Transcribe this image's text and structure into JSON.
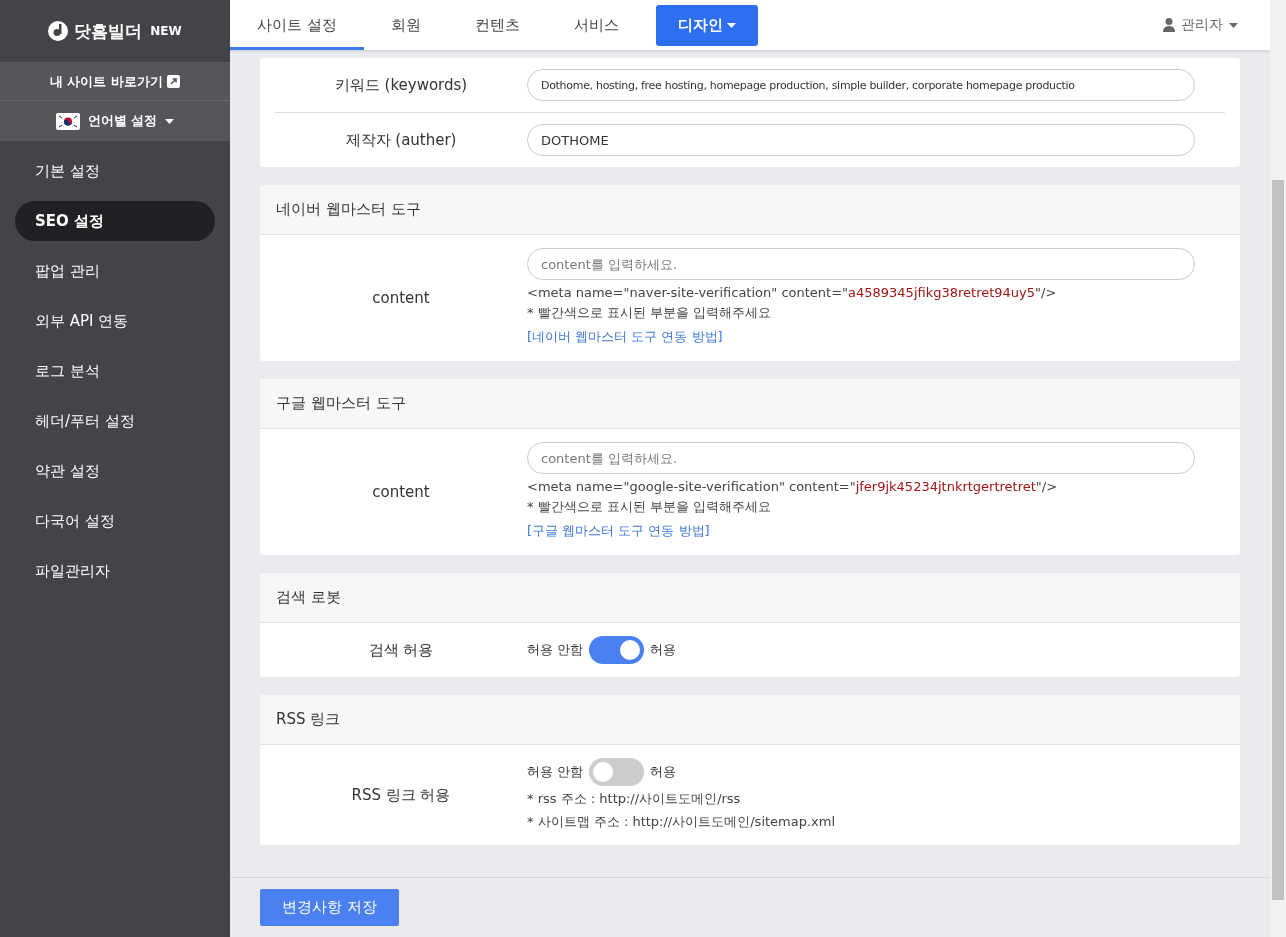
{
  "brand": {
    "name": "닷홈빌더",
    "badge": "NEW"
  },
  "sidebar": {
    "site_link": "내 사이트 바로가기",
    "language": "언어별 설정",
    "items": [
      {
        "label": "기본 설정",
        "selected": false
      },
      {
        "label": "SEO 설정",
        "selected": true
      },
      {
        "label": "팝업 관리",
        "selected": false
      },
      {
        "label": "외부 API 연동",
        "selected": false
      },
      {
        "label": "로그 분석",
        "selected": false
      },
      {
        "label": "헤더/푸터 설정",
        "selected": false
      },
      {
        "label": "약관 설정",
        "selected": false
      },
      {
        "label": "다국어 설정",
        "selected": false
      },
      {
        "label": "파일관리자",
        "selected": false
      }
    ]
  },
  "tabs": [
    {
      "label": "사이트 설정",
      "kind": "tab",
      "selected": true
    },
    {
      "label": "회원",
      "kind": "tab",
      "selected": false
    },
    {
      "label": "컨텐츠",
      "kind": "tab",
      "selected": false
    },
    {
      "label": "서비스",
      "kind": "tab",
      "selected": false
    },
    {
      "label": "디자인",
      "kind": "dropdown",
      "selected": false
    }
  ],
  "user": {
    "name": "관리자"
  },
  "sections": [
    {
      "rows": [
        {
          "kind": "input",
          "label": "키워드 (keywords)",
          "value": "Dothome, hosting, free hosting, homepage production, simple builder, corporate homepage productio"
        },
        {
          "kind": "input",
          "label": "제작자 (auther)",
          "value": "DOTHOME"
        }
      ]
    },
    {
      "title": "네이버 웹마스터 도구",
      "rows": [
        {
          "kind": "meta",
          "label": "content",
          "placeholder": "content를 입력하세요.",
          "meta_prefix": "<meta name=\"naver-site-verification\" content=\"",
          "meta_code": "a4589345jfikg38retret94uy5",
          "meta_suffix": "\"/>",
          "note": "* 빨간색으로 표시된 부분을 입력해주세요",
          "link": "[네이버 웹마스터 도구 연동 방법]"
        }
      ]
    },
    {
      "title": "구글 웹마스터 도구",
      "rows": [
        {
          "kind": "meta",
          "label": "content",
          "placeholder": "content를 입력하세요.",
          "meta_prefix": "<meta name=\"google-site-verification\" content=\"",
          "meta_code": "jfer9jk45234jtnkrtgertretret",
          "meta_suffix": "\"/>",
          "note": "* 빨간색으로 표시된 부분을 입력해주세요",
          "link": "[구글 웹마스터 도구 연동 방법]"
        }
      ]
    },
    {
      "title": "검색 로봇",
      "rows": [
        {
          "kind": "toggle",
          "label": "검색 허용",
          "off_label": "허용 안함",
          "on_label": "허용",
          "on": true
        }
      ]
    },
    {
      "title": "RSS 링크",
      "rows": [
        {
          "kind": "toggle",
          "label": "RSS 링크 허용",
          "off_label": "허용 안함",
          "on_label": "허용",
          "on": false,
          "notes": [
            "* rss 주소 : http://사이트도메인/rss",
            "* 사이트맵 주소 : http://사이트도메인/sitemap.xml"
          ]
        }
      ]
    }
  ],
  "save_button": "변경사항 저장"
}
